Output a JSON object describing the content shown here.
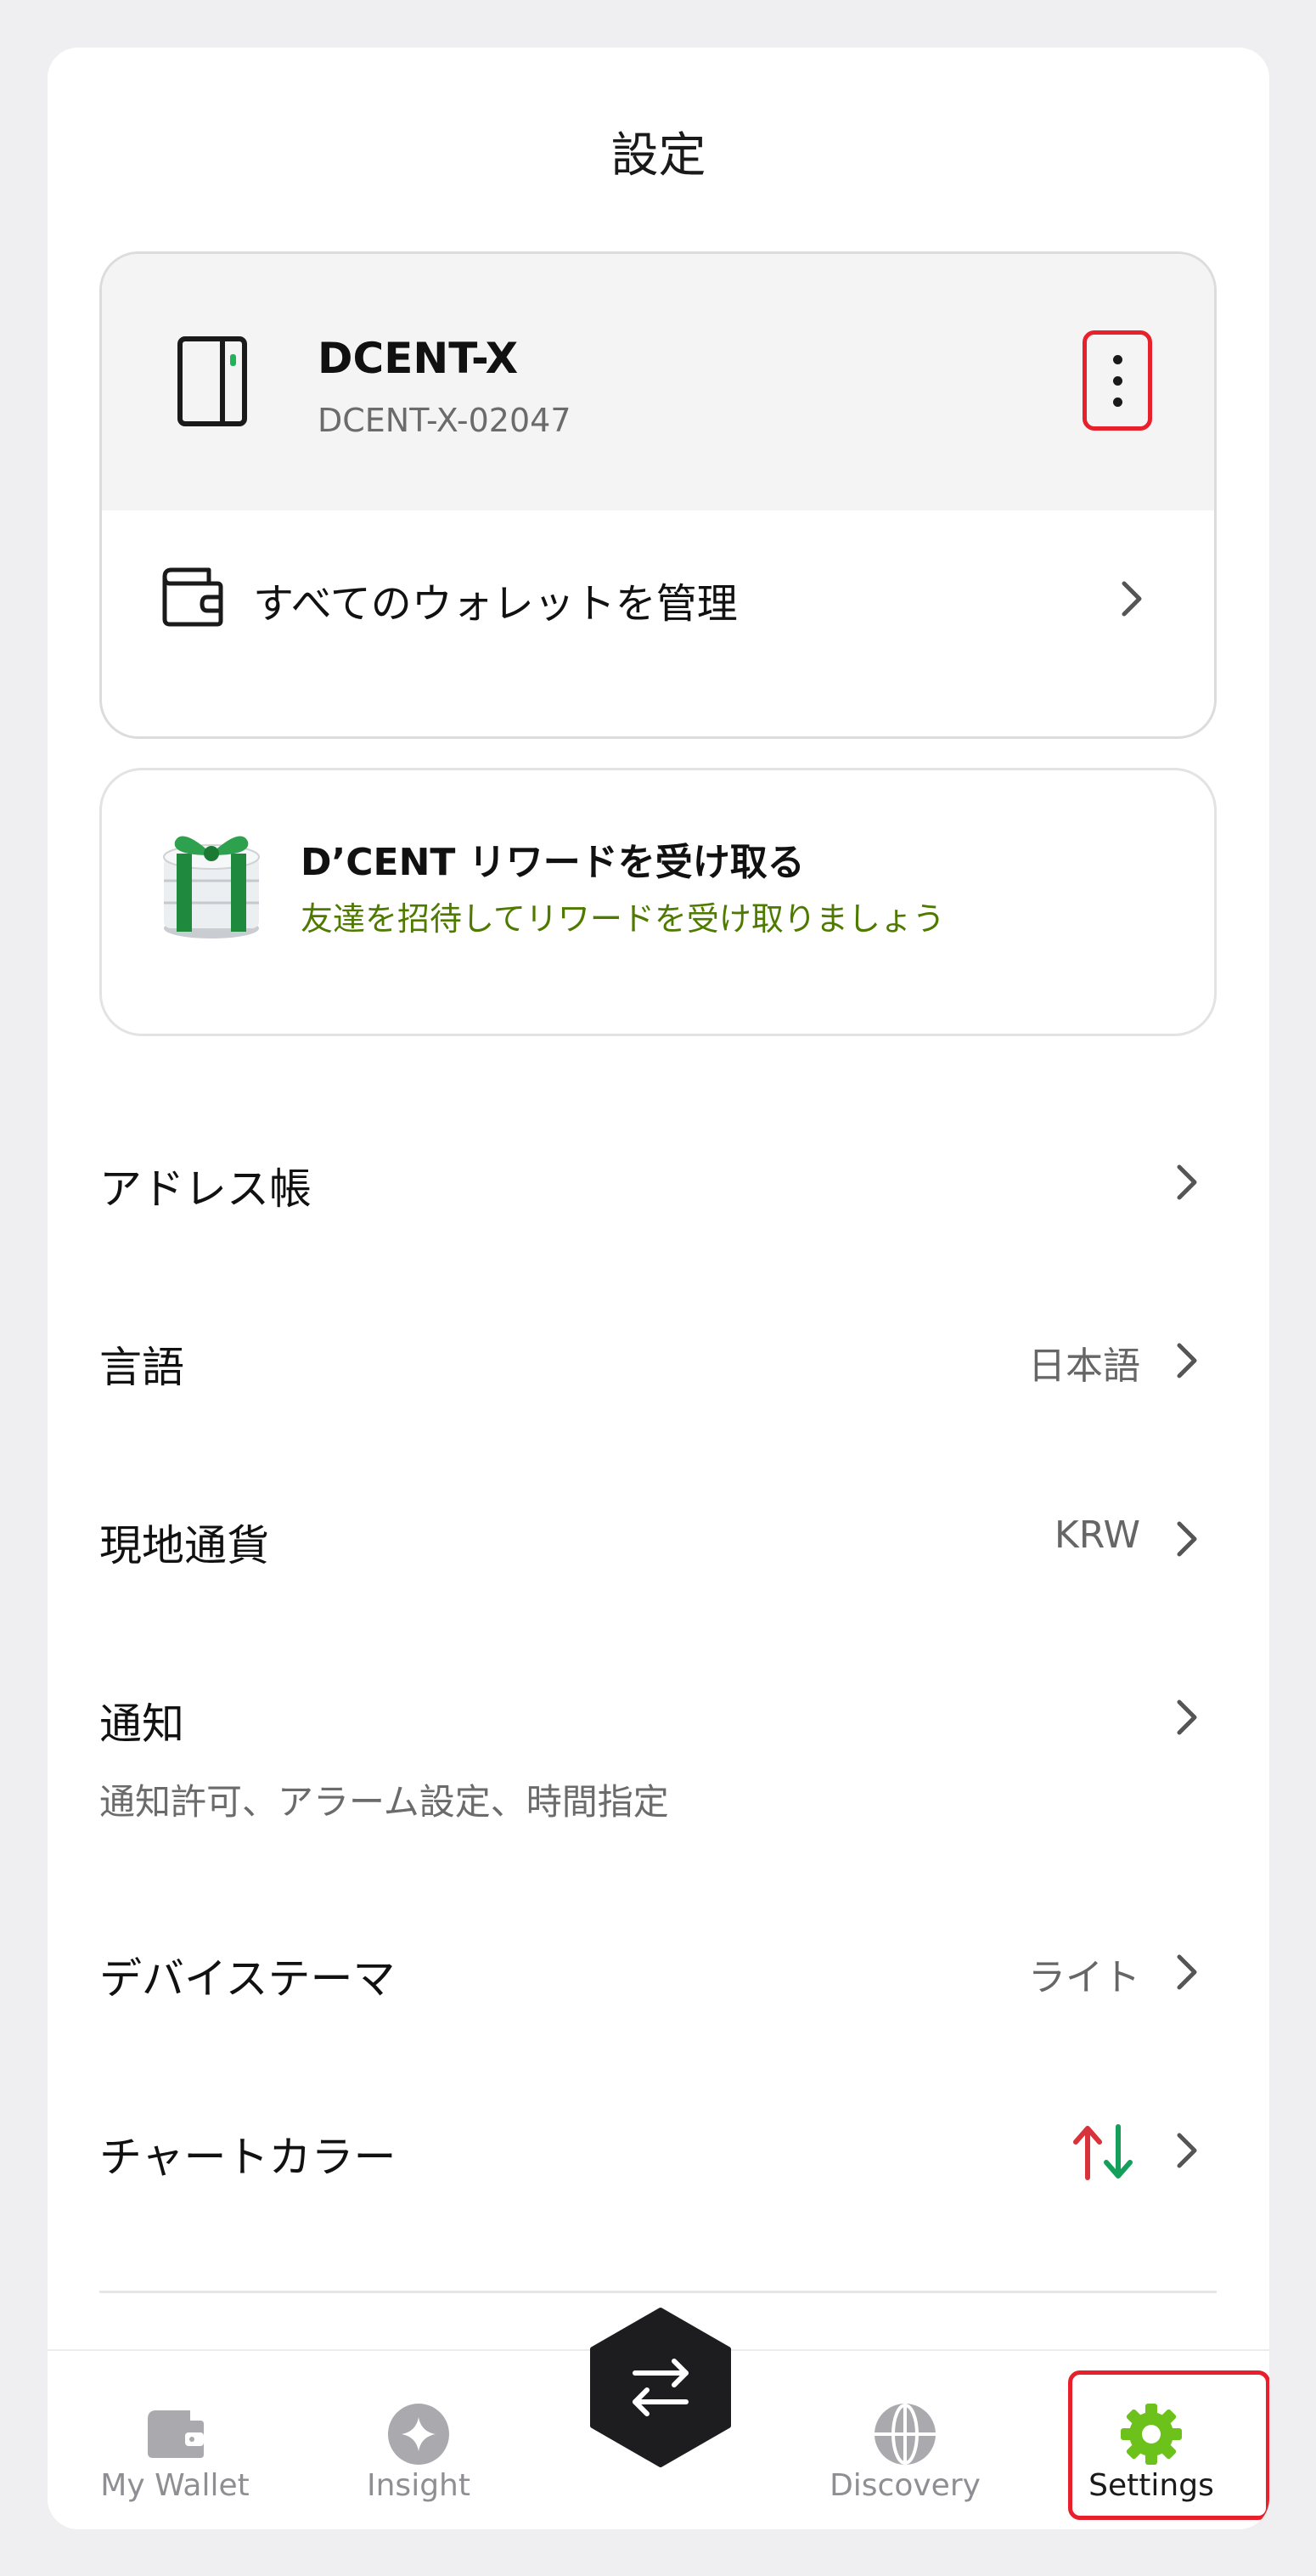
{
  "header": {
    "title": "設定"
  },
  "device": {
    "name": "DCENT-X",
    "id": "DCENT-X-02047",
    "manage_label": "すべてのウォレットを管理"
  },
  "reward": {
    "title": "D’CENT リワードを受け取る",
    "subtitle": "友達を招待してリワードを受け取りましょう"
  },
  "settings": [
    {
      "label": "アドレス帳",
      "value": "",
      "sub": ""
    },
    {
      "label": "言語",
      "value": "日本語",
      "sub": ""
    },
    {
      "label": "現地通貨",
      "value": "KRW",
      "sub": ""
    },
    {
      "label": "通知",
      "value": "",
      "sub": "通知許可、アラーム設定、時間指定"
    },
    {
      "label": "デバイステーマ",
      "value": "ライト",
      "sub": ""
    },
    {
      "label": "チャートカラー",
      "value": "",
      "sub": ""
    }
  ],
  "nav": {
    "wallet": "My Wallet",
    "insight": "Insight",
    "discovery": "Discovery",
    "settings": "Settings"
  },
  "colors": {
    "accent_green": "#6cc21b",
    "highlight_red": "#e8202b",
    "up_red": "#d8333a",
    "down_green": "#14a05a"
  },
  "icons": {
    "device": "device-icon",
    "more": "more-vertical-icon",
    "wallet": "wallet-icon",
    "gift": "gift-icon",
    "chevron": "chevron-right-icon",
    "chart_color": "up-down-arrows-icon",
    "swap": "swap-icon",
    "insight": "sparkle-icon",
    "discovery": "globe-icon",
    "settings": "gear-icon"
  }
}
